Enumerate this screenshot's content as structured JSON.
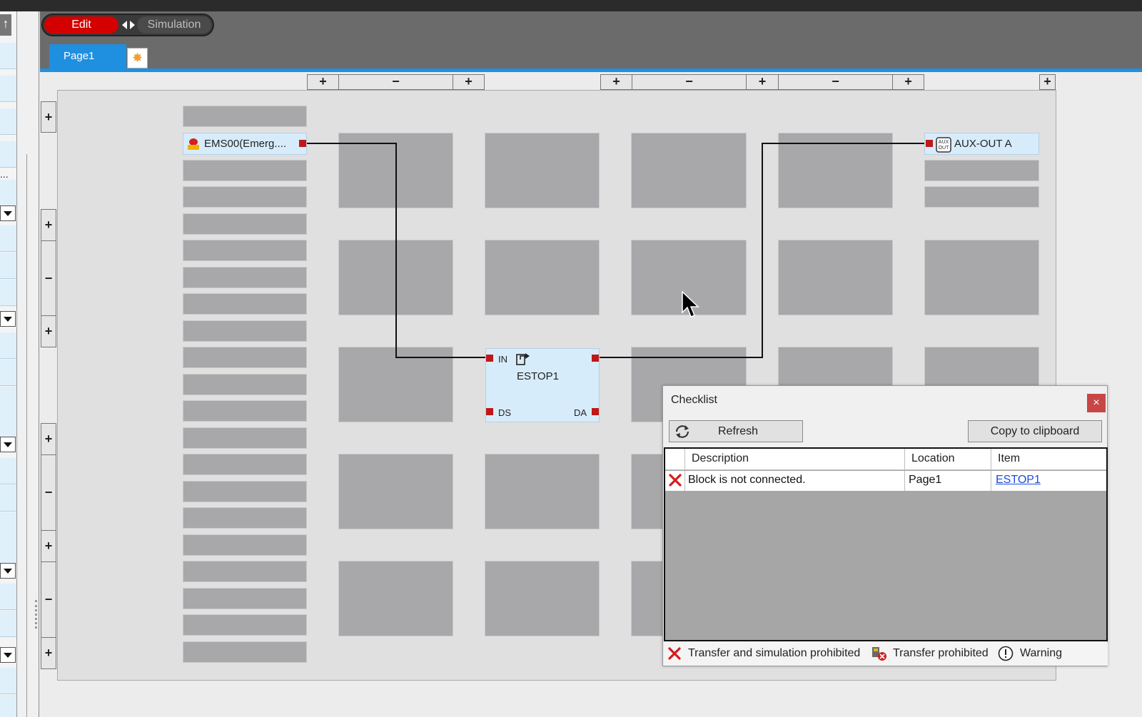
{
  "toolbar": {
    "edit_label": "Edit",
    "simulation_label": "Simulation"
  },
  "tabs": [
    {
      "label": "Page1",
      "active": true
    }
  ],
  "colors": {
    "edit_active": "#d40000",
    "tab_active": "#1f8fe0",
    "port": "#c01818",
    "block_fill": "#d7ecfb",
    "slot_fill": "#a8a8ab"
  },
  "icons": {
    "new_page": "sunburst-icon",
    "emergency": "emergency-stop-icon",
    "aux": "aux-out-icon",
    "estop": "function-block-icon",
    "refresh": "refresh-icon",
    "error": "red-x-icon",
    "transfer_prohibited": "transfer-prohibited-icon",
    "warning": "warning-icon"
  },
  "canvas": {
    "input_block": "EMS00(Emerg....",
    "output_block": "AUX-OUT A",
    "function_block": {
      "name": "ESTOP1",
      "ports": {
        "in": "IN",
        "ds": "DS",
        "da": "DA"
      }
    },
    "column_controls": [
      "+",
      "−",
      "+",
      "+",
      "−",
      "+",
      "−",
      "+",
      "+"
    ],
    "row_controls": [
      "+",
      "+",
      "−",
      "+",
      "+",
      "−",
      "+",
      "−",
      "+"
    ]
  },
  "checklist": {
    "title": "Checklist",
    "close_label": "×",
    "refresh_label": "Refresh",
    "copy_label": "Copy to clipboard",
    "columns": [
      "Description",
      "Location",
      "Item"
    ],
    "rows": [
      {
        "description": "Block is not connected.",
        "location": "Page1",
        "item": "ESTOP1",
        "severity": "transfer-and-simulation-prohibited"
      }
    ],
    "legend": {
      "error": "Transfer and simulation prohibited",
      "transfer": "Transfer prohibited",
      "warning": "Warning"
    }
  },
  "left_panel": {
    "ellipsis": "..."
  }
}
